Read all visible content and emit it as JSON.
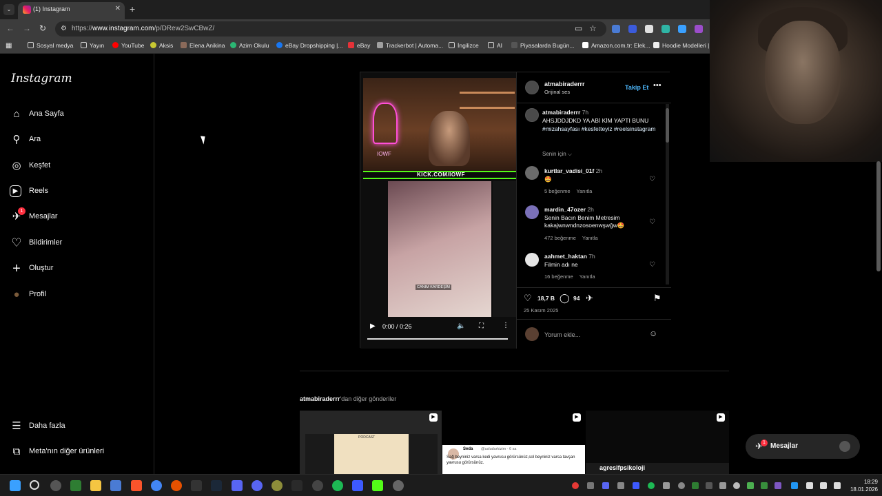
{
  "browser": {
    "tab_title": "(1) Instagram",
    "tab_close": "✕",
    "new_tab": "+",
    "url_prefix": "https://",
    "url_domain": "www.instagram.com",
    "url_path": "/p/DRew2SwCBwZ/"
  },
  "bookmarks": [
    {
      "label": "Sosyal medya",
      "color": "#cfcfcf"
    },
    {
      "label": "Yayın",
      "color": "#cfcfcf"
    },
    {
      "label": "YouTube",
      "color": "#ff0000"
    },
    {
      "label": "Aksis",
      "color": "#c8c832"
    },
    {
      "label": "Elena Anikina",
      "color": "#8a6a5a"
    },
    {
      "label": "Azim Okulu",
      "color": "#2bb673"
    },
    {
      "label": "eBay Dropshipping |...",
      "color": "#1877f2"
    },
    {
      "label": "eBay",
      "color": "#e53238"
    },
    {
      "label": "Trackerbot | Automa...",
      "color": "#a0a0a0"
    },
    {
      "label": "İngilizce",
      "color": "#cfcfcf"
    },
    {
      "label": "AI",
      "color": "#cfcfcf"
    },
    {
      "label": "Piyasalarda Bugün...",
      "color": "#333333"
    },
    {
      "label": "Amazon.com.tr: Elek...",
      "color": "#ffffff"
    },
    {
      "label": "Hoodie Modelleri |",
      "color": "#222222"
    }
  ],
  "sidebar": {
    "logo": "Instagram",
    "items": [
      {
        "label": "Ana Sayfa",
        "icon": "⌂"
      },
      {
        "label": "Ara",
        "icon": "⚲"
      },
      {
        "label": "Keşfet",
        "icon": "◎"
      },
      {
        "label": "Reels",
        "icon": "▶"
      },
      {
        "label": "Mesajlar",
        "icon": "✈",
        "badge": "1"
      },
      {
        "label": "Bildirimler",
        "icon": "♡"
      },
      {
        "label": "Oluştur",
        "icon": "+"
      },
      {
        "label": "Profil",
        "icon": "●"
      }
    ],
    "more": "Daha fazla",
    "meta": "Meta'nın diğer ürünleri"
  },
  "post": {
    "author": "atmabiraderrr",
    "audio": "Orijinal ses",
    "follow": "Takip Et",
    "caption_user": "atmabiraderrr",
    "caption_time": "7h",
    "caption_text": "AHSJDDJDKD YA ABİ KİM YAPTI BUNU",
    "caption_tags": "#mizahsayfası #kesfetteyiz #reelsinstagram",
    "for_you": "Senin için ⌵",
    "video": {
      "kick_text": "KICK.COM/IOWF",
      "neon_text": "IOWF",
      "inner_caption": "CANIM KARDEŞİM",
      "time": "0:00 / 0:26"
    },
    "comments": [
      {
        "user": "kurtlar_vadisi_01f",
        "time": "2h",
        "text": "🤩",
        "likes": "5 beğenme",
        "reply": "Yanıtla"
      },
      {
        "user": "mardin_47ozer",
        "time": "2h",
        "text": "Senin Bacın Benim Metresim kakajwnwndnzosoenwşwğw🤩",
        "likes": "472 beğenme",
        "reply": "Yanıtla"
      },
      {
        "user": "aahmet_haktan",
        "time": "7h",
        "text": "Filmin adı ne",
        "likes": "16 beğenme",
        "reply": "Yanıtla"
      }
    ],
    "like_count": "18,7 B",
    "comment_count": "94",
    "date": "25 Kasım 2025",
    "add_comment": "Yorum ekle..."
  },
  "more_posts": {
    "user": "atmabiraderrr",
    "suffix": "'dan diğer gönderiler",
    "thumb1_label": "PODCAST",
    "thumb2_user": "Seda",
    "thumb2_handle": "@usludurkizim · 6 sa",
    "thumb2_text": "Sağ beyniniz varsa kedi yavrusu görürsünüz,sol beyniniz varsa tavşan yavrusu görürsünüz.",
    "thumb3_text": "agresifpsikoloji"
  },
  "messages_button": {
    "label": "Mesajlar",
    "badge": "1"
  },
  "clock": {
    "time": "18:29",
    "date": "18.01.2026"
  }
}
